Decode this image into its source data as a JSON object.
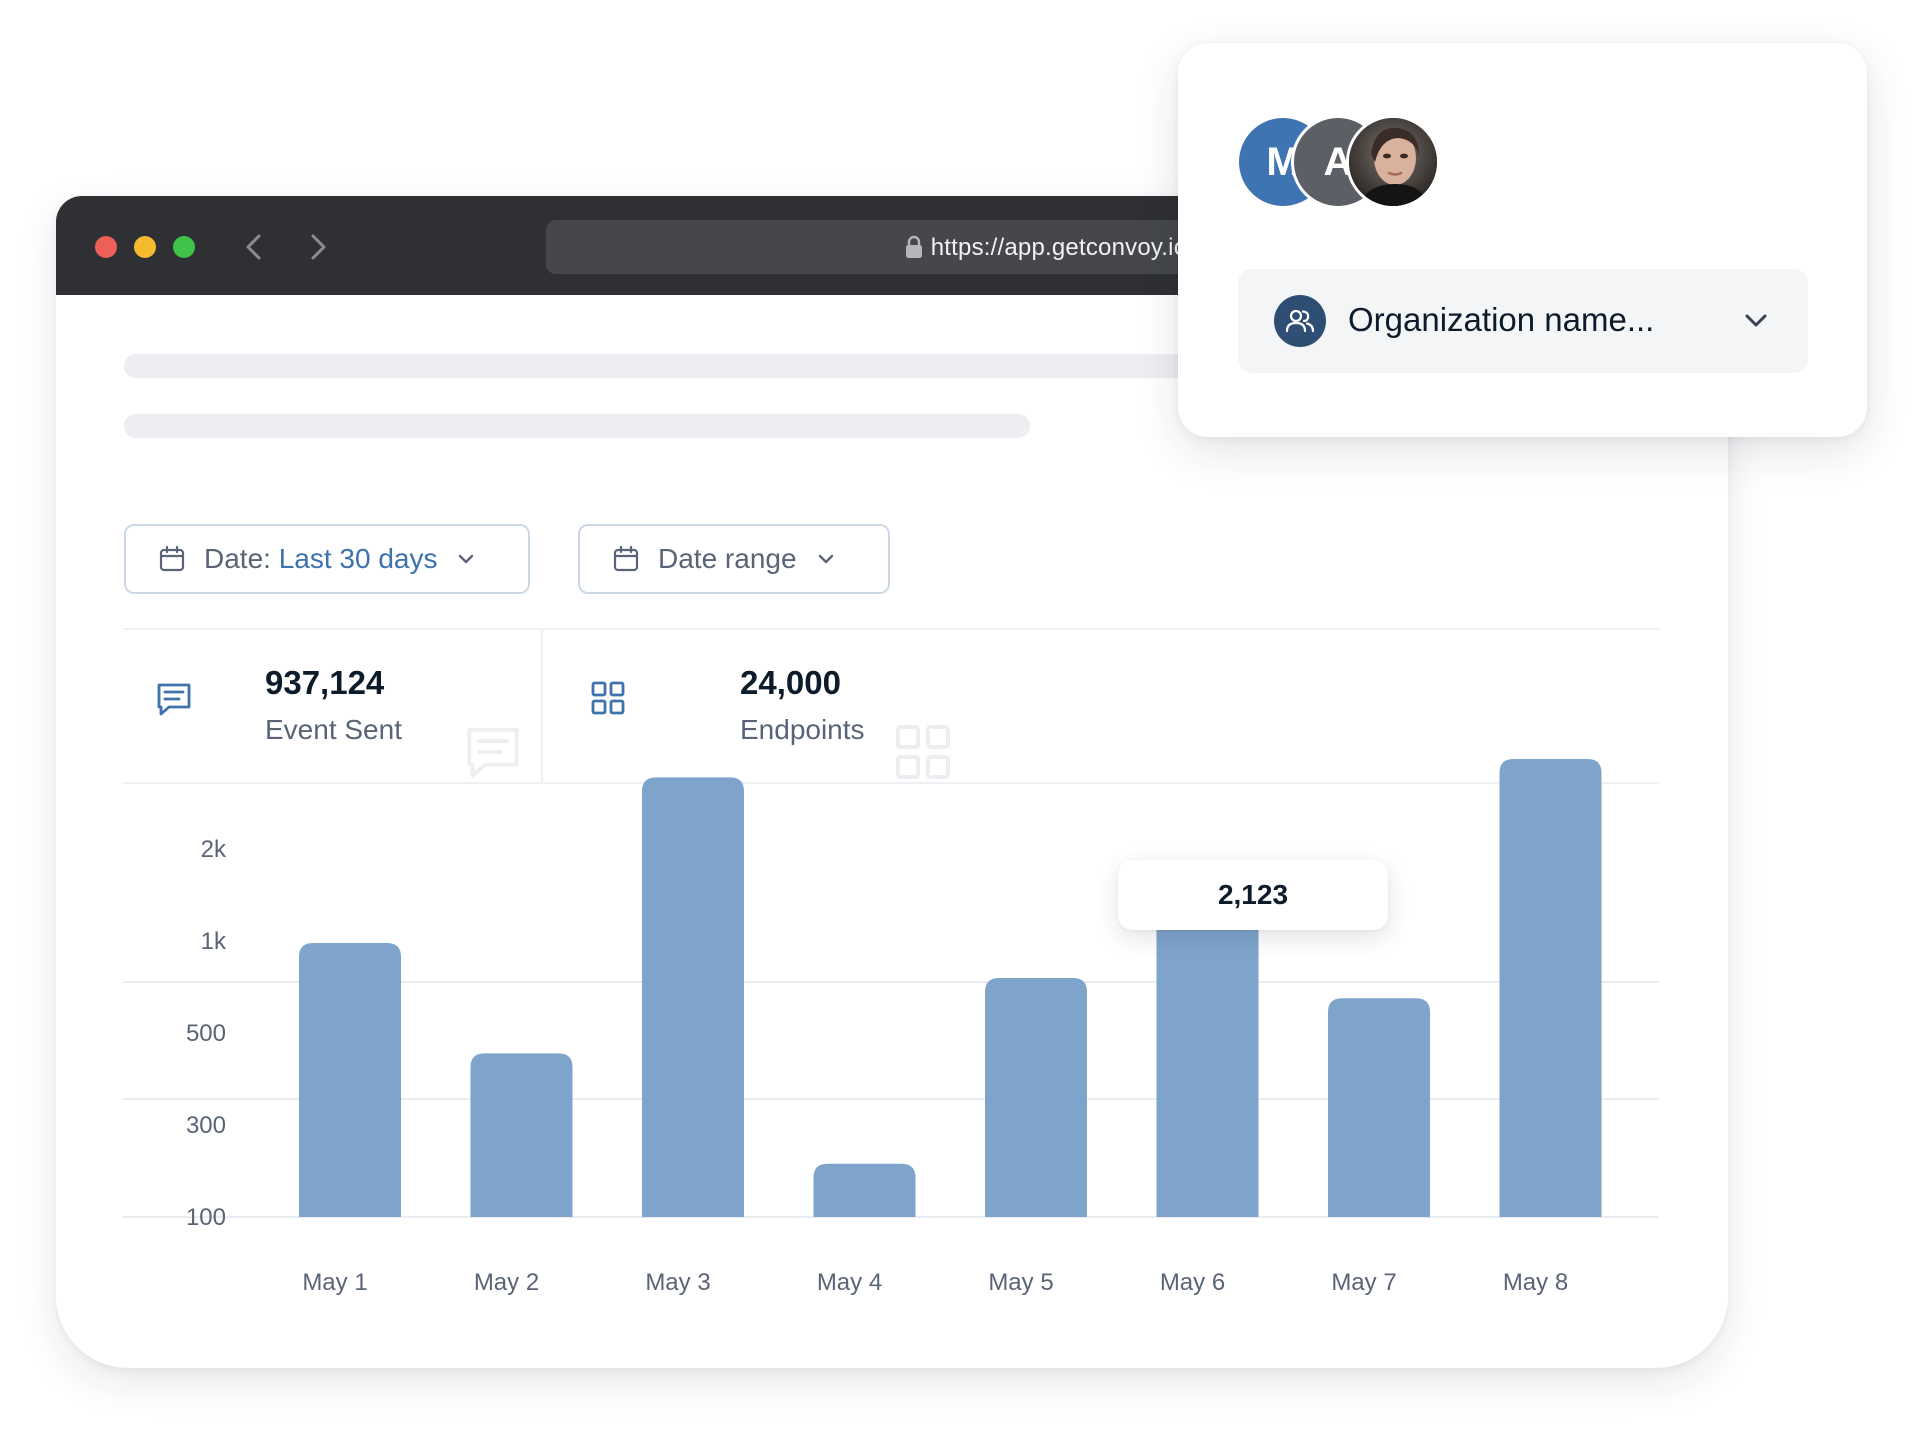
{
  "browser": {
    "url": "https://app.getconvoy.io"
  },
  "filters": {
    "date_prefix": "Date: ",
    "date_value": "Last 30 days",
    "range_label": "Date range"
  },
  "stats": [
    {
      "value": "937,124",
      "label": "Event Sent",
      "icon": "message-icon"
    },
    {
      "value": "24,000",
      "label": "Endpoints",
      "icon": "grid-icon"
    }
  ],
  "tooltip": {
    "value": "2,123"
  },
  "org": {
    "avatars": [
      {
        "initial": "M",
        "color": "#3f74b3"
      },
      {
        "initial": "A",
        "color": "#5c5f66"
      },
      {
        "initial": "",
        "kind": "photo"
      }
    ],
    "name": "Organization name...",
    "icon": "users-icon"
  },
  "colors": {
    "accent": "#3d72ad",
    "bar": "#7ea4cb",
    "titlebar": "#2f3033"
  },
  "chart_data": {
    "type": "bar",
    "categories": [
      "May 1",
      "May 2",
      "May 3",
      "May 4",
      "May 5",
      "May 6",
      "May 7",
      "May 8"
    ],
    "values": [
      750,
      360,
      2300,
      120,
      560,
      1000,
      480,
      2500
    ],
    "y_ticks": [
      "100",
      "300",
      "500",
      "1k",
      "2k"
    ],
    "highlighted": {
      "category": "May 6",
      "label": "2,123"
    },
    "grid": true
  }
}
